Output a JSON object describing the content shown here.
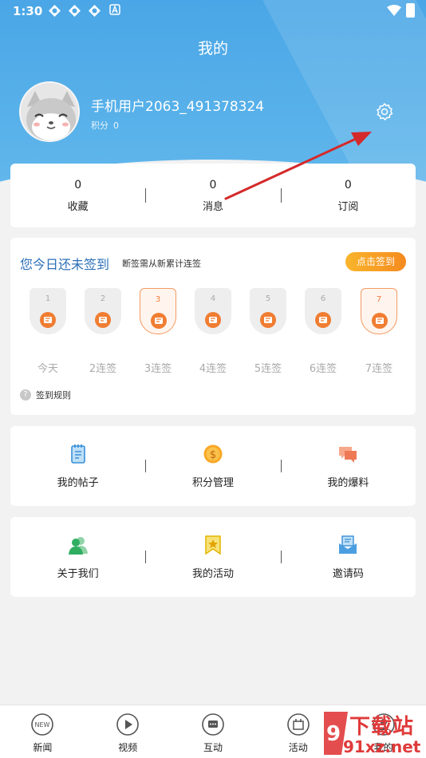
{
  "status_bar": {
    "time": "1:30"
  },
  "page_title": "我的",
  "user": {
    "name": "手机用户2063_491378324",
    "points_label": "积分",
    "points_value": "0"
  },
  "stats": [
    {
      "value": "0",
      "label": "收藏"
    },
    {
      "value": "0",
      "label": "消息"
    },
    {
      "value": "0",
      "label": "订阅"
    }
  ],
  "checkin": {
    "title": "您今日还未签到",
    "subtitle": "断签需从新累计连签",
    "button_label": "点击签到",
    "days": [
      {
        "num": "1",
        "label": "今天",
        "highlighted": false
      },
      {
        "num": "2",
        "label": "2连签",
        "highlighted": false
      },
      {
        "num": "3",
        "label": "3连签",
        "highlighted": true
      },
      {
        "num": "4",
        "label": "4连签",
        "highlighted": false
      },
      {
        "num": "5",
        "label": "5连签",
        "highlighted": false
      },
      {
        "num": "6",
        "label": "6连签",
        "highlighted": false
      },
      {
        "num": "7",
        "label": "7连签",
        "highlighted": true
      }
    ],
    "rules_label": "签到规则"
  },
  "menu_row_1": [
    {
      "label": "我的帖子",
      "icon": "notepad-icon"
    },
    {
      "label": "积分管理",
      "icon": "coin-icon"
    },
    {
      "label": "我的爆料",
      "icon": "chat-bubble-icon"
    }
  ],
  "menu_row_2": [
    {
      "label": "关于我们",
      "icon": "users-icon"
    },
    {
      "label": "我的活动",
      "icon": "star-flag-icon"
    },
    {
      "label": "邀请码",
      "icon": "envelope-icon"
    }
  ],
  "tabbar": [
    {
      "label": "新闻",
      "icon": "new-icon",
      "icon_text": "NEW"
    },
    {
      "label": "视频",
      "icon": "play-icon"
    },
    {
      "label": "互动",
      "icon": "message-icon"
    },
    {
      "label": "活动",
      "icon": "activity-icon"
    },
    {
      "label": "我的",
      "icon": "profile-icon"
    }
  ],
  "watermark": {
    "line1": "下载站",
    "line2": "91xz.net"
  },
  "colors": {
    "header_blue": "#4aa6e6",
    "title_blue": "#2b6fb8",
    "orange": "#f58a1f",
    "annotation_red": "#d42a2a"
  }
}
